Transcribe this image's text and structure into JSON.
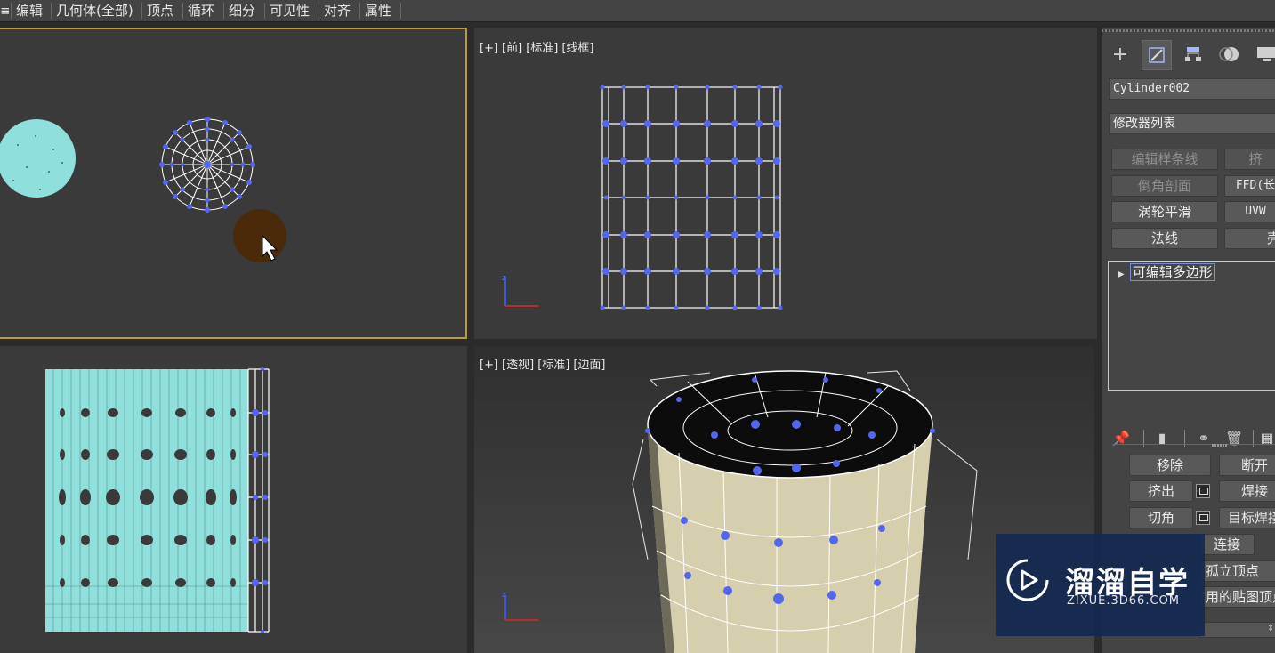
{
  "menubar": {
    "items": [
      "≡",
      "编辑",
      "几何体(全部)",
      "顶点",
      "循环",
      "细分",
      "可见性",
      "对齐",
      "属性"
    ]
  },
  "viewports": {
    "front": {
      "labels": [
        "[+]",
        "[前]",
        "[标准]",
        "[线框]"
      ]
    },
    "perspective": {
      "labels": [
        "[+]",
        "[透视]",
        "[标准]",
        "[边面]"
      ]
    }
  },
  "command_panel": {
    "tabs": [
      "create-icon",
      "modify-icon",
      "hierarchy-icon",
      "motion-icon",
      "display-icon"
    ],
    "active_tab": "modify-icon",
    "object_name": "Cylinder002",
    "modifier_list": "修改器列表",
    "modifier_buttons": [
      {
        "label": "编辑样条线",
        "dim": true
      },
      {
        "label": "挤",
        "dim": true
      },
      {
        "label": "倒角剖面",
        "dim": true
      },
      {
        "label": "FFD(长",
        "dim": false
      },
      {
        "label": "涡轮平滑",
        "dim": false
      },
      {
        "label": "UVW",
        "dim": false
      },
      {
        "label": "法线",
        "dim": false
      },
      {
        "label": "壳",
        "dim": false
      }
    ],
    "stack_item": "可编辑多边形",
    "edit_vertices": {
      "remove": "移除",
      "break": "断开",
      "extrude": "挤出",
      "weld": "焊接",
      "chamfer": "切角",
      "target_weld": "目标焊接",
      "connect": "连接",
      "remove_isolated": "孤立顶点",
      "remove_unused_map": "用的贴图顶点"
    }
  },
  "watermark": {
    "title": "溜溜自学",
    "url": "ZIXUE.3D66.COM"
  },
  "colors": {
    "viewport_bg": "#3a3a3a",
    "active_border": "#b89a4a",
    "wire": "#ffffff",
    "vertex": "#5566ee",
    "cyan_mesh": "#8fe0dc",
    "cup_surface": "#d6cfae",
    "watermark_bg": "#14285a"
  }
}
